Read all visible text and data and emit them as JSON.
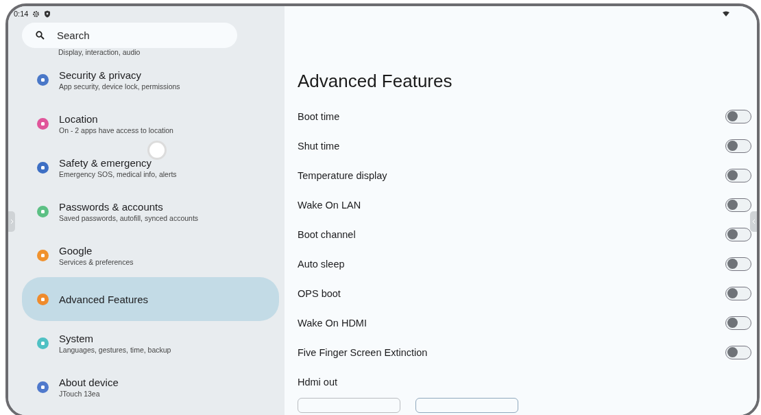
{
  "status_bar": {
    "time": "0:14"
  },
  "search": {
    "placeholder": "Search"
  },
  "sidebar": {
    "items": [
      {
        "subtitle": "Display, interaction, audio",
        "selected": false
      },
      {
        "title": "Security & privacy",
        "subtitle": "App security, device lock, permissions",
        "color": "#4a78c8",
        "selected": false
      },
      {
        "title": "Location",
        "subtitle": "On - 2 apps have access to location",
        "color": "#e0559a",
        "selected": false
      },
      {
        "title": "Safety & emergency",
        "subtitle": "Emergency SOS, medical info, alerts",
        "color": "#3d6fc4",
        "selected": false
      },
      {
        "title": "Passwords & accounts",
        "subtitle": "Saved passwords, autofill, synced accounts",
        "color": "#5cc084",
        "selected": false
      },
      {
        "title": "Google",
        "subtitle": "Services & preferences",
        "color": "#f0922e",
        "selected": false
      },
      {
        "title": "Advanced Features",
        "color": "#ef8b2c",
        "selected": true
      },
      {
        "title": "System",
        "subtitle": "Languages, gestures, time, backup",
        "color": "#4fc1c4",
        "selected": false
      },
      {
        "title": "About device",
        "subtitle": "JTouch 13ea",
        "color": "#4f79cc",
        "selected": false
      }
    ]
  },
  "content": {
    "title": "Advanced Features",
    "settings": [
      {
        "label": "Boot time",
        "kind": "toggle",
        "on": false
      },
      {
        "label": "Shut time",
        "kind": "toggle",
        "on": false
      },
      {
        "label": "Temperature display",
        "kind": "toggle",
        "on": false
      },
      {
        "label": "Wake On LAN",
        "kind": "toggle",
        "on": false
      },
      {
        "label": "Boot channel",
        "kind": "toggle",
        "on": false
      },
      {
        "label": "Auto sleep",
        "kind": "toggle",
        "on": false
      },
      {
        "label": "OPS boot",
        "kind": "toggle",
        "on": false
      },
      {
        "label": "Wake On HDMI",
        "kind": "toggle",
        "on": false
      },
      {
        "label": "Five Finger Screen Extinction",
        "kind": "toggle",
        "on": false
      },
      {
        "label": "Hdmi out",
        "kind": "options",
        "options": [
          {
            "selected": false
          },
          {
            "selected": true
          }
        ]
      }
    ]
  }
}
